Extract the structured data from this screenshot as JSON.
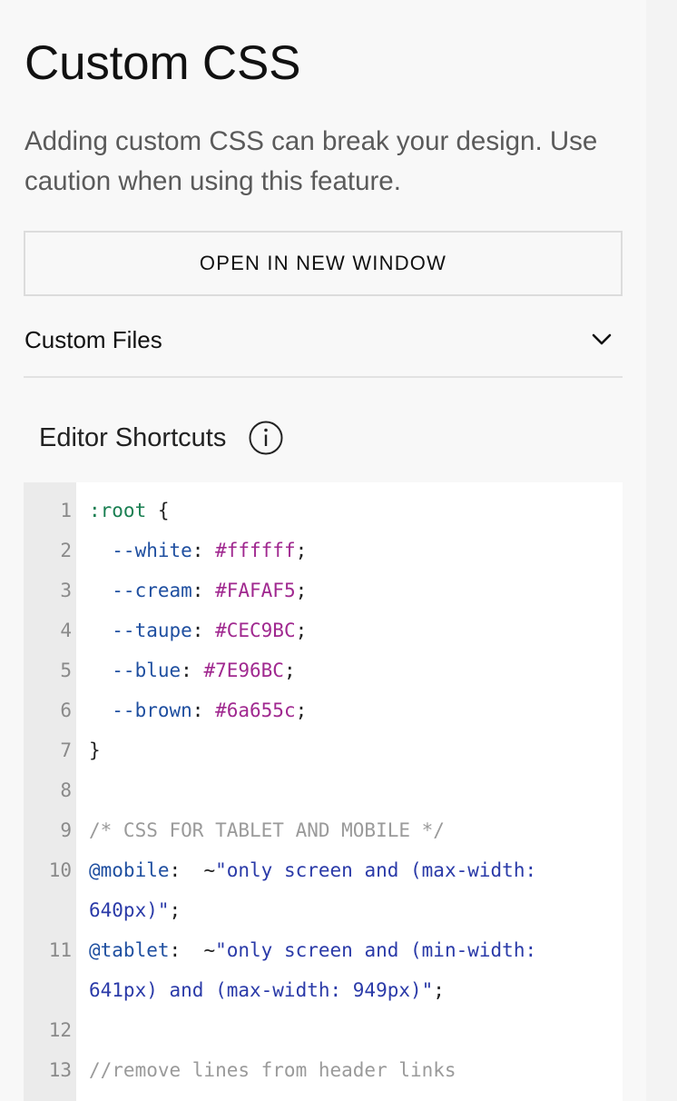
{
  "header": {
    "title": "Custom CSS",
    "description": "Adding custom CSS can break your design. Use caution when using this feature."
  },
  "actions": {
    "open_window_label": "OPEN IN NEW WINDOW"
  },
  "custom_files": {
    "label": "Custom Files",
    "icon": "chevron-down-icon"
  },
  "editor": {
    "shortcuts_label": "Editor Shortcuts",
    "shortcuts_icon": "info-icon",
    "lines": [
      {
        "num": "1",
        "tokens": [
          {
            "t": ":root",
            "c": "sel"
          },
          {
            "t": " {",
            "c": "punc"
          }
        ]
      },
      {
        "num": "2",
        "tokens": [
          {
            "t": "  --white",
            "c": "prop"
          },
          {
            "t": ": ",
            "c": "punc"
          },
          {
            "t": "#ffffff",
            "c": "val"
          },
          {
            "t": ";",
            "c": "punc"
          }
        ]
      },
      {
        "num": "3",
        "tokens": [
          {
            "t": "  --cream",
            "c": "prop"
          },
          {
            "t": ": ",
            "c": "punc"
          },
          {
            "t": "#FAFAF5",
            "c": "val"
          },
          {
            "t": ";",
            "c": "punc"
          }
        ]
      },
      {
        "num": "4",
        "tokens": [
          {
            "t": "  --taupe",
            "c": "prop"
          },
          {
            "t": ": ",
            "c": "punc"
          },
          {
            "t": "#CEC9BC",
            "c": "val"
          },
          {
            "t": ";",
            "c": "punc"
          }
        ]
      },
      {
        "num": "5",
        "tokens": [
          {
            "t": "  --blue",
            "c": "prop"
          },
          {
            "t": ": ",
            "c": "punc"
          },
          {
            "t": "#7E96BC",
            "c": "val"
          },
          {
            "t": ";",
            "c": "punc"
          }
        ]
      },
      {
        "num": "6",
        "tokens": [
          {
            "t": "  --brown",
            "c": "prop"
          },
          {
            "t": ": ",
            "c": "punc"
          },
          {
            "t": "#6a655c",
            "c": "val"
          },
          {
            "t": ";",
            "c": "punc"
          }
        ]
      },
      {
        "num": "7",
        "tokens": [
          {
            "t": "}",
            "c": "punc"
          }
        ]
      },
      {
        "num": "8",
        "tokens": []
      },
      {
        "num": "9",
        "tokens": [
          {
            "t": "/* CSS FOR TABLET AND MOBILE */",
            "c": "cmt"
          }
        ]
      },
      {
        "num": "10",
        "tokens": [
          {
            "t": "@mobile",
            "c": "at"
          },
          {
            "t": ":  ~",
            "c": "punc"
          },
          {
            "t": "\"only screen and (max-width:",
            "c": "str"
          }
        ]
      },
      {
        "num": "",
        "tokens": [
          {
            "t": "640px)\"",
            "c": "str"
          },
          {
            "t": ";",
            "c": "punc"
          }
        ]
      },
      {
        "num": "11",
        "tokens": [
          {
            "t": "@tablet",
            "c": "at"
          },
          {
            "t": ":  ~",
            "c": "punc"
          },
          {
            "t": "\"only screen and (min-width:",
            "c": "str"
          }
        ]
      },
      {
        "num": "",
        "tokens": [
          {
            "t": "641px) and (max-width: 949px)\"",
            "c": "str"
          },
          {
            "t": ";",
            "c": "punc"
          }
        ]
      },
      {
        "num": "12",
        "tokens": []
      },
      {
        "num": "13",
        "tokens": [
          {
            "t": "//remove lines from header links",
            "c": "cmt"
          }
        ]
      }
    ]
  },
  "colors": {
    "syntax_selector": "#1a7f52",
    "syntax_property": "#1f4fa0",
    "syntax_value": "#a0288f",
    "syntax_string": "#2a3aa8",
    "syntax_comment": "#9a9a9a"
  }
}
